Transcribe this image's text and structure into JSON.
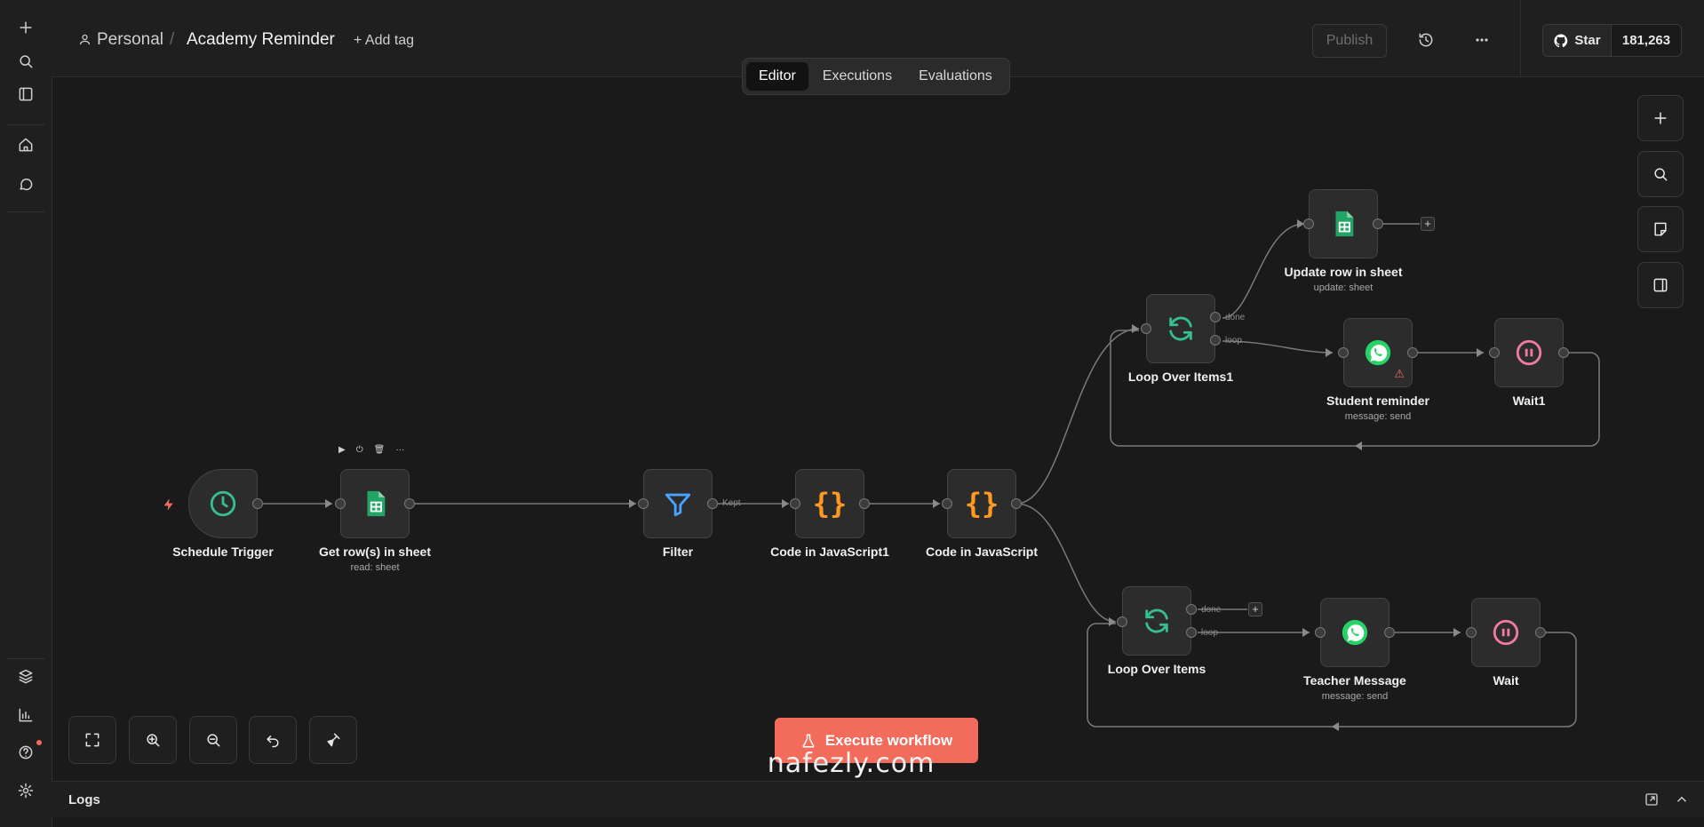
{
  "header": {
    "project": "Personal",
    "separator": "/",
    "workflow_name": "Academy Reminder",
    "add_tag": "+ Add tag",
    "publish": "Publish",
    "github_star": "Star",
    "github_count": "181,263"
  },
  "tabs": [
    "Editor",
    "Executions",
    "Evaluations"
  ],
  "active_tab": "Editor",
  "nodes": {
    "schedule_trigger": {
      "label": "Schedule Trigger",
      "icon": "clock-icon"
    },
    "get_rows": {
      "label": "Get row(s) in sheet",
      "sub": "read: sheet",
      "icon": "google-sheets-icon"
    },
    "filter": {
      "label": "Filter",
      "icon": "filter-icon"
    },
    "code_js1": {
      "label": "Code in JavaScript1",
      "icon": "code-braces-icon"
    },
    "code_js": {
      "label": "Code in JavaScript",
      "icon": "code-braces-icon"
    },
    "loop_over_items1": {
      "label": "Loop Over Items1",
      "icon": "loop-icon"
    },
    "update_row": {
      "label": "Update row in sheet",
      "sub": "update: sheet",
      "icon": "google-sheets-icon"
    },
    "student_reminder": {
      "label": "Student reminder",
      "sub": "message: send",
      "icon": "whatsapp-icon"
    },
    "wait1": {
      "label": "Wait1",
      "icon": "pause-icon"
    },
    "loop_over_items": {
      "label": "Loop Over Items",
      "icon": "loop-icon"
    },
    "teacher_message": {
      "label": "Teacher Message",
      "sub": "message: send",
      "icon": "whatsapp-icon"
    },
    "wait": {
      "label": "Wait",
      "icon": "pause-icon"
    }
  },
  "edge_labels": {
    "kept": "Kept",
    "done": "done",
    "loop": "loop"
  },
  "execute_button": "Execute workflow",
  "logs": "Logs",
  "watermark": "nafezly.com",
  "colors": {
    "accent": "#f26b5b",
    "sheets_green": "#21a464",
    "filter_blue": "#4aa3ff",
    "code_orange": "#ff9922",
    "loop_teal": "#35c08e",
    "whatsapp_green": "#25d366",
    "wait_pink": "#f27ba0"
  }
}
